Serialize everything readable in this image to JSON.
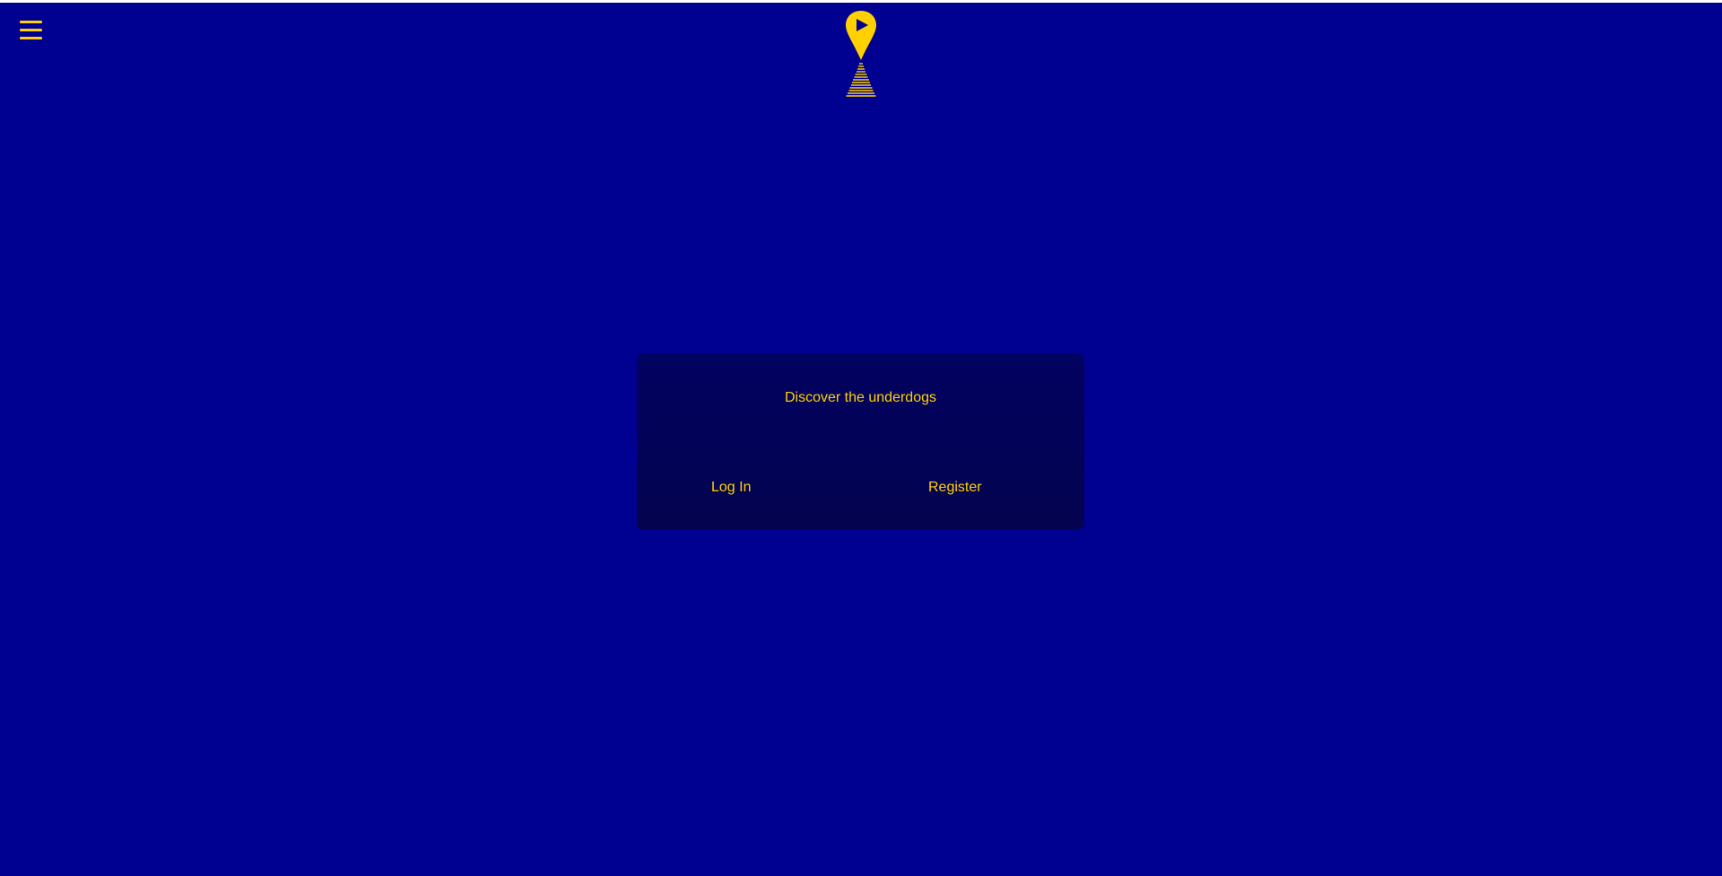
{
  "colors": {
    "background": "#000091",
    "card": "#03034f",
    "accent": "#ffd100"
  },
  "header": {
    "menu_icon": "hamburger-menu-icon",
    "logo_icon": "location-pin-play-icon"
  },
  "card": {
    "tagline": "Discover the underdogs",
    "login_label": "Log In",
    "register_label": "Register"
  }
}
